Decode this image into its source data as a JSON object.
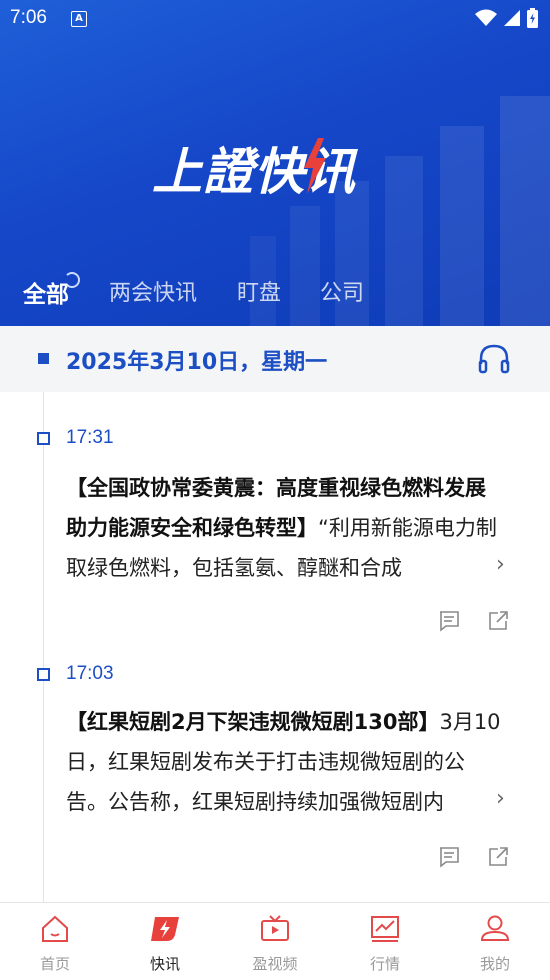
{
  "status_bar": {
    "time": "7:06",
    "a_badge": "A"
  },
  "header": {
    "logo_text": "上證快讯",
    "tabs": [
      {
        "label": "全部",
        "active": true
      },
      {
        "label": "两会快讯",
        "active": false
      },
      {
        "label": "盯盘",
        "active": false
      },
      {
        "label": "公司",
        "active": false
      }
    ]
  },
  "date_bar": {
    "date": "2025年3月10日，星期一"
  },
  "news": [
    {
      "time": "17:31",
      "title": "【全国政协常委黄震：高度重视绿色燃料发展 助力能源安全和绿色转型】",
      "body": "“利用新能源电力制取绿色燃料，包括氢氨、醇醚和合成"
    },
    {
      "time": "17:03",
      "title": "【红果短剧2月下架违规微短剧130部】",
      "body": "3月10日，红果短剧发布关于打击违规微短剧的公告。公告称，红果短剧持续加强微短剧内"
    }
  ],
  "bottom_nav": [
    {
      "label": "首页",
      "icon": "home-icon"
    },
    {
      "label": "快讯",
      "icon": "flash-icon",
      "active": true
    },
    {
      "label": "盈视频",
      "icon": "tv-icon"
    },
    {
      "label": "行情",
      "icon": "chart-icon"
    },
    {
      "label": "我的",
      "icon": "user-icon"
    }
  ],
  "colors": {
    "brand_blue": "#1c4ec4",
    "accent_red": "#e8403a",
    "nav_red": "#e34b4b"
  }
}
